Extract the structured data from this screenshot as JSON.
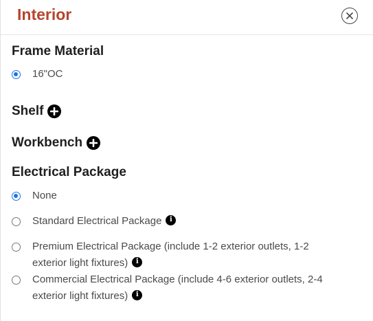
{
  "header": {
    "title": "Interior"
  },
  "frame_material": {
    "title": "Frame Material",
    "options": [
      {
        "label": "16\"OC",
        "selected": true
      }
    ]
  },
  "shelf": {
    "title": "Shelf"
  },
  "workbench": {
    "title": "Workbench"
  },
  "electrical_package": {
    "title": "Electrical Package",
    "options": [
      {
        "label": "None",
        "selected": true,
        "info": false
      },
      {
        "label": "Standard Electrical Package",
        "selected": false,
        "info": true
      },
      {
        "label": "Premium Electrical Package (include 1-2 exterior outlets, 1-2 exterior light fixtures)",
        "selected": false,
        "info": true
      },
      {
        "label": "Commercial Electrical Package (include 4-6 exterior outlets, 2-4 exterior light fixtures)",
        "selected": false,
        "info": true
      }
    ]
  },
  "colors": {
    "title_accent": "#b5452d",
    "radio_selected": "#1a73e8"
  },
  "icons": {
    "close": "close-circle-icon",
    "add": "plus-circle-icon",
    "info": "info-circle-icon"
  }
}
